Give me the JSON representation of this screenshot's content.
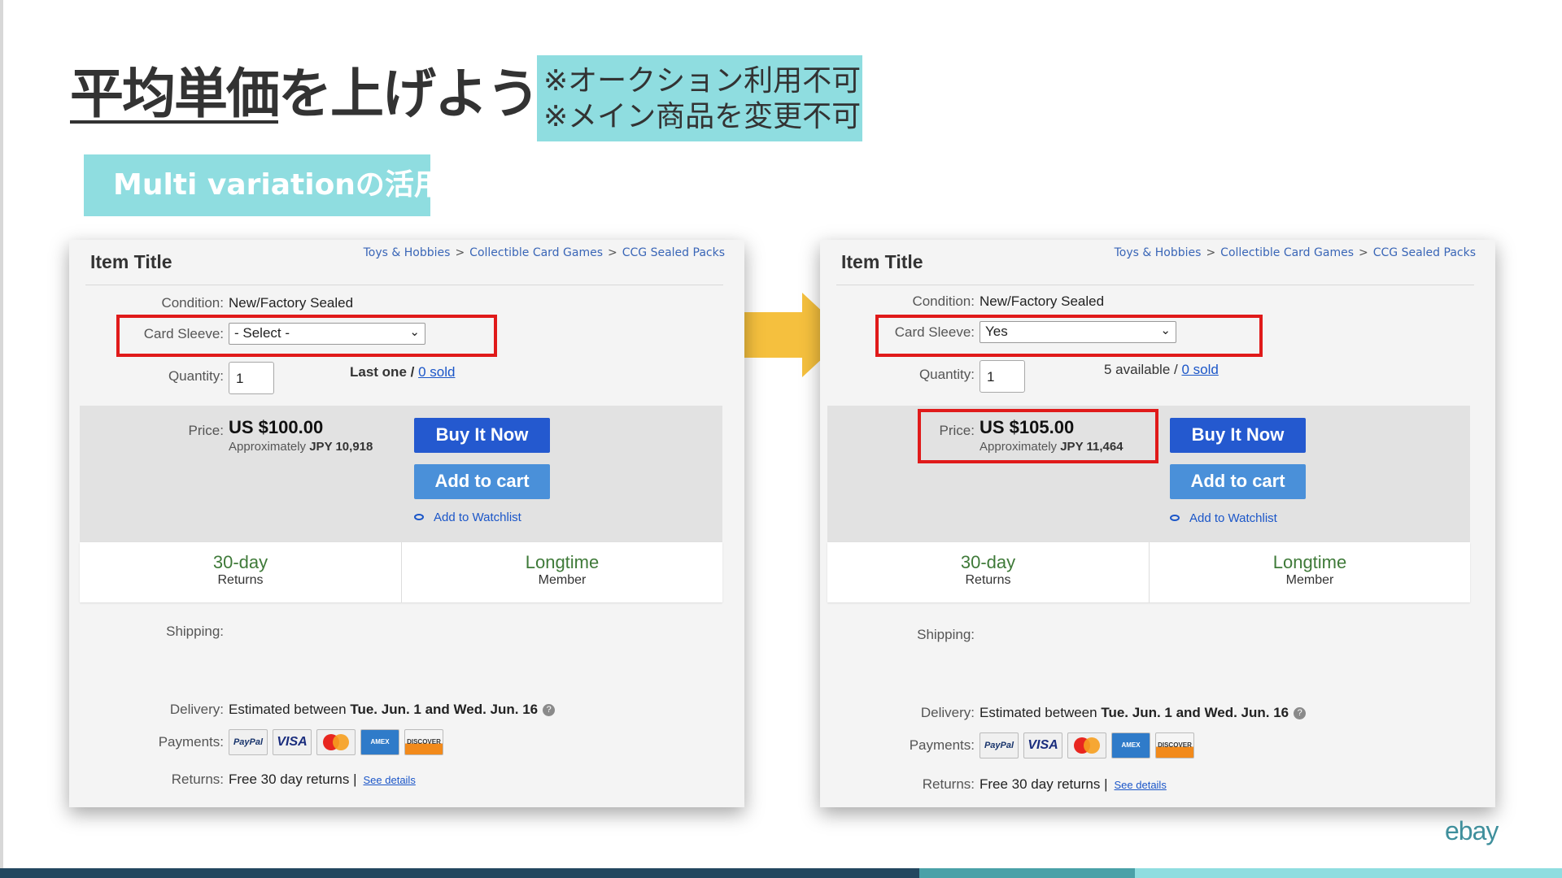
{
  "slide": {
    "title_underlined": "平均単価",
    "title_rest": "を上げよう",
    "notes": [
      "※オークション利用不可",
      "※メイン商品を変更不可"
    ],
    "tag": "Multi variationの活用"
  },
  "panels": [
    {
      "item_title": "Item Title",
      "breadcrumbs": [
        "Toys & Hobbies",
        "Collectible Card Games",
        "CCG Sealed Packs"
      ],
      "condition_label": "Condition:",
      "condition_value": "New/Factory Sealed",
      "sleeve_label": "Card Sleeve:",
      "sleeve_value": "- Select -",
      "quantity_label": "Quantity:",
      "quantity_value": "1",
      "availability": "Last one",
      "sold_sep": " / ",
      "sold": "0 sold",
      "price_label": "Price:",
      "price": "US $100.00",
      "approx_prefix": "Approximately",
      "approx_value": "JPY 10,918",
      "buy_label": "Buy It Now",
      "cart_label": "Add to cart",
      "watch_label": "Add to Watchlist",
      "returns_badge_big": "30-day",
      "returns_badge_small": "Returns",
      "member_badge_big": "Longtime",
      "member_badge_small": "Member",
      "shipping_label": "Shipping:",
      "delivery_label": "Delivery:",
      "delivery_prefix": "Estimated between",
      "delivery_dates": "Tue. Jun. 1 and Wed. Jun. 16",
      "payments_label": "Payments:",
      "payment_icons": [
        "PayPal",
        "VISA",
        "mastercard",
        "AMERICAN EXPRESS",
        "DISCOVER"
      ],
      "returns_label": "Returns:",
      "returns_value": "Free 30 day returns |",
      "see_details": "See details"
    },
    {
      "item_title": "Item Title",
      "breadcrumbs": [
        "Toys & Hobbies",
        "Collectible Card Games",
        "CCG Sealed Packs"
      ],
      "condition_label": "Condition:",
      "condition_value": "New/Factory Sealed",
      "sleeve_label": "Card Sleeve:",
      "sleeve_value": "Yes",
      "quantity_label": "Quantity:",
      "quantity_value": "1",
      "availability": "5 available",
      "sold_sep": " / ",
      "sold": "0 sold",
      "price_label": "Price:",
      "price": "US $105.00",
      "approx_prefix": "Approximately",
      "approx_value": "JPY 11,464",
      "buy_label": "Buy It Now",
      "cart_label": "Add to cart",
      "watch_label": "Add to Watchlist",
      "returns_badge_big": "30-day",
      "returns_badge_small": "Returns",
      "member_badge_big": "Longtime",
      "member_badge_small": "Member",
      "shipping_label": "Shipping:",
      "delivery_label": "Delivery:",
      "delivery_prefix": "Estimated between",
      "delivery_dates": "Tue. Jun. 1 and Wed. Jun. 16",
      "payments_label": "Payments:",
      "payment_icons": [
        "PayPal",
        "VISA",
        "mastercard",
        "AMERICAN EXPRESS",
        "DISCOVER"
      ],
      "returns_label": "Returns:",
      "returns_value": "Free 30 day returns |",
      "see_details": "See details"
    }
  ],
  "logo": "ebay",
  "colors": {
    "accent": "#8fdde0",
    "highlight": "#e01a1a",
    "arrow": "#f5c03e",
    "buy_button": "#2459cf",
    "cart_button": "#4a90d9"
  }
}
